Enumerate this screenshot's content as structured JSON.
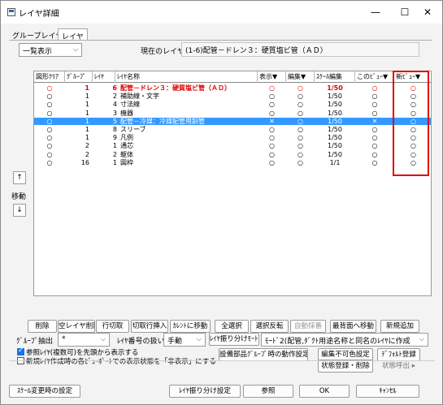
{
  "window": {
    "title": "レイヤ詳細",
    "minimize_glyph": "—",
    "maximize_glyph": "☐",
    "close_glyph": "✕"
  },
  "tabs": [
    "グループレイヤ",
    "レイヤ"
  ],
  "view_select": {
    "value": "一覧表示"
  },
  "current_layer": {
    "label": "現在のレイヤ",
    "value": "(1-6)配管－ドレン３：硬質塩ビ管（ＡＤ）"
  },
  "table": {
    "columns": [
      "図形ｸﾘｱ",
      "ｸﾞﾙｰﾌﾟ",
      "ﾚｲﾔ",
      "ﾚｲﾔ名称",
      "表示▼",
      "編集▼",
      "ｽｹｰﾙ編集",
      "このﾋﾞｭｰ▼",
      "新ﾋﾞｭｰ▼"
    ],
    "rows": [
      {
        "clear": "○",
        "group": "1",
        "layer": "6",
        "name": "配管－ドレン３：硬質塩ビ管（ＡＤ）",
        "show": "○",
        "edit": "○",
        "scale": "1/50",
        "thisview": "○",
        "newview": "○",
        "state": "current"
      },
      {
        "clear": "○",
        "group": "1",
        "layer": "2",
        "name": "補助線・文字",
        "show": "○",
        "edit": "○",
        "scale": "1/50",
        "thisview": "○",
        "newview": "○",
        "state": ""
      },
      {
        "clear": "○",
        "group": "1",
        "layer": "4",
        "name": "寸法線",
        "show": "○",
        "edit": "○",
        "scale": "1/50",
        "thisview": "○",
        "newview": "○",
        "state": ""
      },
      {
        "clear": "○",
        "group": "1",
        "layer": "3",
        "name": "機器",
        "show": "○",
        "edit": "○",
        "scale": "1/50",
        "thisview": "○",
        "newview": "○",
        "state": ""
      },
      {
        "clear": "○",
        "group": "1",
        "layer": "5",
        "name": "配管－冷媒：冷媒配管用銅管",
        "show": "✕",
        "edit": "○",
        "scale": "1/50",
        "thisview": "✕",
        "newview": "○",
        "state": "selected"
      },
      {
        "clear": "○",
        "group": "1",
        "layer": "8",
        "name": "スリーブ",
        "show": "○",
        "edit": "○",
        "scale": "1/50",
        "thisview": "○",
        "newview": "○",
        "state": ""
      },
      {
        "clear": "○",
        "group": "1",
        "layer": "9",
        "name": "凡例",
        "show": "○",
        "edit": "○",
        "scale": "1/50",
        "thisview": "○",
        "newview": "○",
        "state": ""
      },
      {
        "clear": "○",
        "group": "2",
        "layer": "1",
        "name": "通芯",
        "show": "○",
        "edit": "○",
        "scale": "1/50",
        "thisview": "○",
        "newview": "○",
        "state": ""
      },
      {
        "clear": "○",
        "group": "2",
        "layer": "2",
        "name": "躯体",
        "show": "○",
        "edit": "○",
        "scale": "1/50",
        "thisview": "○",
        "newview": "○",
        "state": ""
      },
      {
        "clear": "○",
        "group": "16",
        "layer": "1",
        "name": "図枠",
        "show": "○",
        "edit": "○",
        "scale": "1/1",
        "thisview": "○",
        "newview": "○",
        "state": ""
      }
    ]
  },
  "side": {
    "up": "↑",
    "move_label": "移動",
    "down": "↓"
  },
  "buttons_row1": [
    "削除",
    "空レイヤ削除",
    "行切取",
    "切取行挿入",
    "ｶﾚﾝﾄに移動",
    "全選択",
    "選択反転",
    "自動採番",
    "最背面へ移動",
    "新規追加"
  ],
  "group_extract": {
    "label": "ｸﾞﾙｰﾌﾟ抽出",
    "value": "*"
  },
  "layer_number": {
    "label": "ﾚｲﾔ番号の扱い",
    "value": "手動"
  },
  "layer_split": {
    "label": "ﾚｲﾔ振り分けﾓｰﾄﾞ",
    "value": "ﾓｰﾄﾞ2(配管,ﾀﾞｸﾄ用途名称と同名のﾚｲﾔに作成"
  },
  "checks": [
    {
      "label": "参照ﾚｲﾔ(複数可)を先頭から表示する",
      "checked": true
    },
    {
      "label": "新規ﾚｲﾔ作成時の各ﾋﾞｭｰﾎﾟｰﾄでの表示状態を「非表示」にする",
      "checked": false
    }
  ],
  "buttons_row3": {
    "group_action": "設備部品ｸﾞﾙｰﾌﾟ時の動作設定",
    "noedit_color": "編集不可色設定",
    "default_register": "ﾃﾞﾌｫﾙﾄ登録"
  },
  "buttons_row4": {
    "state_register": "状態登録・削除",
    "state_call": "状態呼出 ▸"
  },
  "footer": {
    "scale_setting": "ｽｹｰﾙ変更時の設定",
    "layer_split_setting": "ﾚｲﾔ振り分け設定",
    "ref": "参照",
    "ok": "OK",
    "cancel": "ｷｬﾝｾﾙ"
  },
  "colors": {
    "selected_row": "#3399ff",
    "highlight_box": "#e00000",
    "current_row_text": "#e00000"
  }
}
